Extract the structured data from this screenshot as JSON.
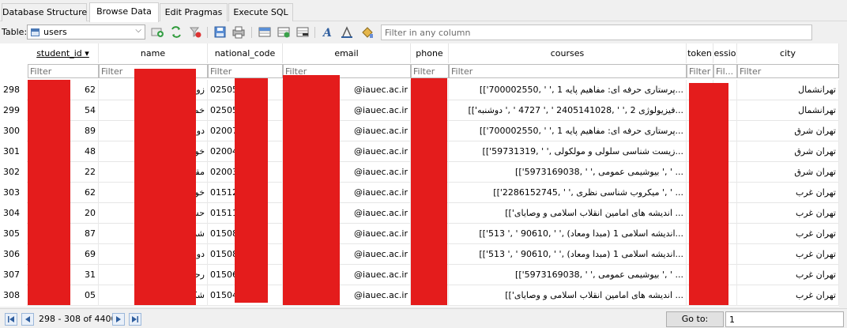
{
  "tabs": [
    {
      "label": "Database Structure",
      "active": false
    },
    {
      "label": "Browse Data",
      "active": true
    },
    {
      "label": "Edit Pragmas",
      "active": false
    },
    {
      "label": "Execute SQL",
      "active": false
    }
  ],
  "toolbar": {
    "table_label": "Table:",
    "table_value": "users",
    "filter_placeholder": "Filter in any column",
    "icons": [
      "refresh-icon",
      "clear-filters-icon",
      "save-table-icon",
      "print-icon",
      "insert-record-icon",
      "delete-record-icon",
      "font-icon",
      "text-color-icon",
      "background-color-icon"
    ]
  },
  "grid": {
    "columns": [
      {
        "label": "student_id ▾",
        "sorted": true
      },
      {
        "label": "name"
      },
      {
        "label": "national_code"
      },
      {
        "label": "email"
      },
      {
        "label": "phone"
      },
      {
        "label": "courses"
      },
      {
        "label": "token"
      },
      {
        "label": "essio"
      },
      {
        "label": "city"
      }
    ],
    "filters": [
      "Filter",
      "Filter",
      "Filter",
      "Filter",
      "Filter",
      "Filter",
      "Filter",
      "Fil...",
      "Filter"
    ],
    "rows": [
      {
        "num": "298",
        "student_id": "62",
        "name": "زوله اي",
        "national_code": "02505",
        "email": "@iauec.ac.ir",
        "courses": "...پرستاری حرفه ای: مفاهیم پایه 1 ,' ' ,700002550']]",
        "city": "تهرانشمال"
      },
      {
        "num": "299",
        "student_id": "54",
        "name": "خمسه",
        "national_code": "02505",
        "email": "@iauec.ac.ir",
        "courses": "...فیزیولوژی 2 ,' ' ,2405141028 ' ,' 4727 ' ,' دوشنبه']]",
        "city": "تهرانشمال"
      },
      {
        "num": "300",
        "student_id": "89",
        "name": "دوست",
        "national_code": "02007",
        "email": "@iauec.ac.ir",
        "courses": "...پرستاری حرفه ای: مفاهیم پایه 1 ,' ' ,700002550']]",
        "city": "تهران شرق"
      },
      {
        "num": "301",
        "student_id": "48",
        "name": "خوانیایه",
        "national_code": "02004",
        "email": "@iauec.ac.ir",
        "courses": "...زیست شناسی سلولی و مولکولی ,' ' ,59731319']]",
        "city": "تهران شرق"
      },
      {
        "num": "302",
        "student_id": "22",
        "name": "مقنيان",
        "national_code": "02003",
        "email": "@iauec.ac.ir",
        "courses": "... ' ,' بیوشیمی عمومی ,' ' ,5973169038']]",
        "city": "تهران شرق"
      },
      {
        "num": "303",
        "student_id": "62",
        "name": "خونديان",
        "national_code": "01512",
        "email": "@iauec.ac.ir",
        "courses": "... ' ,' میکروب شناسی نظری ,' ' ,2286152745']]",
        "city": "تهران غرب"
      },
      {
        "num": "304",
        "student_id": "20",
        "name": "حسينلو",
        "national_code": "01511",
        "email": "@iauec.ac.ir",
        "courses": "... اندیشه های امامین انقلاب اسلامی و وصایای']]",
        "city": "تهران غرب"
      },
      {
        "num": "305",
        "student_id": "87",
        "name": "شريفي",
        "national_code": "01508",
        "email": "@iauec.ac.ir",
        "courses": "...اندیشه اسلامی 1 (مبدا ومعاد) ,' ' ,90610 ' ,' 513']]",
        "city": "تهران غرب"
      },
      {
        "num": "306",
        "student_id": "69",
        "name": "دودران",
        "national_code": "01508",
        "email": "@iauec.ac.ir",
        "courses": "...اندیشه اسلامی 1 (مبدا ومعاد) ,' ' ,90610 ' ,' 513']]",
        "city": "تهران غرب"
      },
      {
        "num": "307",
        "student_id": "31",
        "name": "رحماني",
        "national_code": "01506",
        "email": "@iauec.ac.ir",
        "courses": "... ' ,' بیوشیمی عمومی ,' ' ,5973169038']]",
        "city": "تهران غرب"
      },
      {
        "num": "308",
        "student_id": "05",
        "name": "شكريان",
        "national_code": "01504",
        "email": "@iauec.ac.ir",
        "courses": "... اندیشه های امامین انقلاب اسلامی و وصایای']]",
        "city": "تهران غرب"
      }
    ]
  },
  "status": {
    "range": "298 - 308 of 4400",
    "goto_label": "Go to:",
    "goto_value": "1"
  },
  "colors": {
    "redaction": "#e41c1c",
    "accent": "#4a78b5"
  }
}
